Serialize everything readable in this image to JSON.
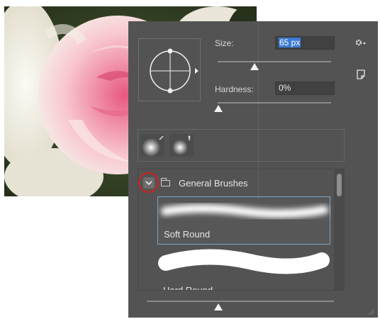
{
  "brush_panel": {
    "size_label": "Size:",
    "size_value": "65 px",
    "hardness_label": "Hardness:",
    "hardness_value": "0%",
    "settings_icon": "gear-dropdown-icon",
    "new_preset_icon": "new-preset-icon"
  },
  "brush_group": {
    "name": "General Brushes",
    "expand_icon": "chevron-down-icon",
    "folder_icon": "folder-icon"
  },
  "brushes": [
    {
      "name": "Soft Round"
    },
    {
      "name": "Hard Round"
    }
  ],
  "colors": {
    "panel_bg": "#535353",
    "selection_highlight": "#3c7bd4",
    "callout_ring": "#d0201f"
  }
}
